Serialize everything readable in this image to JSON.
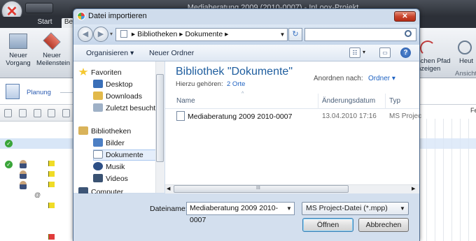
{
  "app": {
    "title": "Mediaberatung 2009 (2010-0007) - InLoox-Projekt",
    "tabs": [
      "Start",
      "Be"
    ],
    "ribbon_buttons": [
      {
        "label": "Neuer Vorgang",
        "icon": "task-icon"
      },
      {
        "label": "Neuer Meilenstein",
        "icon": "milestone-icon"
      }
    ],
    "ribbon_right": [
      "schen Pfad",
      "nzeigen",
      "Heut"
    ],
    "group_label": "Ansicht",
    "panel_label": "Planung",
    "gantt_header": "Fe"
  },
  "dialog": {
    "title": "Datei importieren",
    "breadcrumb": [
      "Bibliotheken",
      "Dokumente"
    ],
    "search_placeholder": "",
    "toolbar": {
      "organize": "Organisieren ▾",
      "new_folder": "Neuer Ordner"
    },
    "nav": {
      "favorites_header": "Favoriten",
      "favorites": [
        "Desktop",
        "Downloads",
        "Zuletzt besucht"
      ],
      "libraries_header": "Bibliotheken",
      "libraries": [
        "Bilder",
        "Dokumente",
        "Musik",
        "Videos"
      ],
      "computer": "Computer",
      "selected": "Dokumente"
    },
    "content": {
      "library_title": "Bibliothek \"Dokumente\"",
      "includes_label": "Hierzu gehören:",
      "includes_value": "2 Orte",
      "arrange_label": "Anordnen nach:",
      "arrange_value": "Ordner ▾",
      "columns": [
        "Name",
        "Änderungsdatum",
        "Typ"
      ],
      "files": [
        {
          "name": "Mediaberatung 2009 2010-0007",
          "date": "13.04.2010 17:16",
          "type": "MS Projec"
        }
      ],
      "hscroll_mark": "III"
    },
    "filename_label": "Dateiname:",
    "filename_value": "Mediaberatung 2009 2010-0007",
    "filetype_value": "MS Project-Datei (*.mpp)",
    "open_label": "Öffnen",
    "cancel_label": "Abbrechen"
  }
}
